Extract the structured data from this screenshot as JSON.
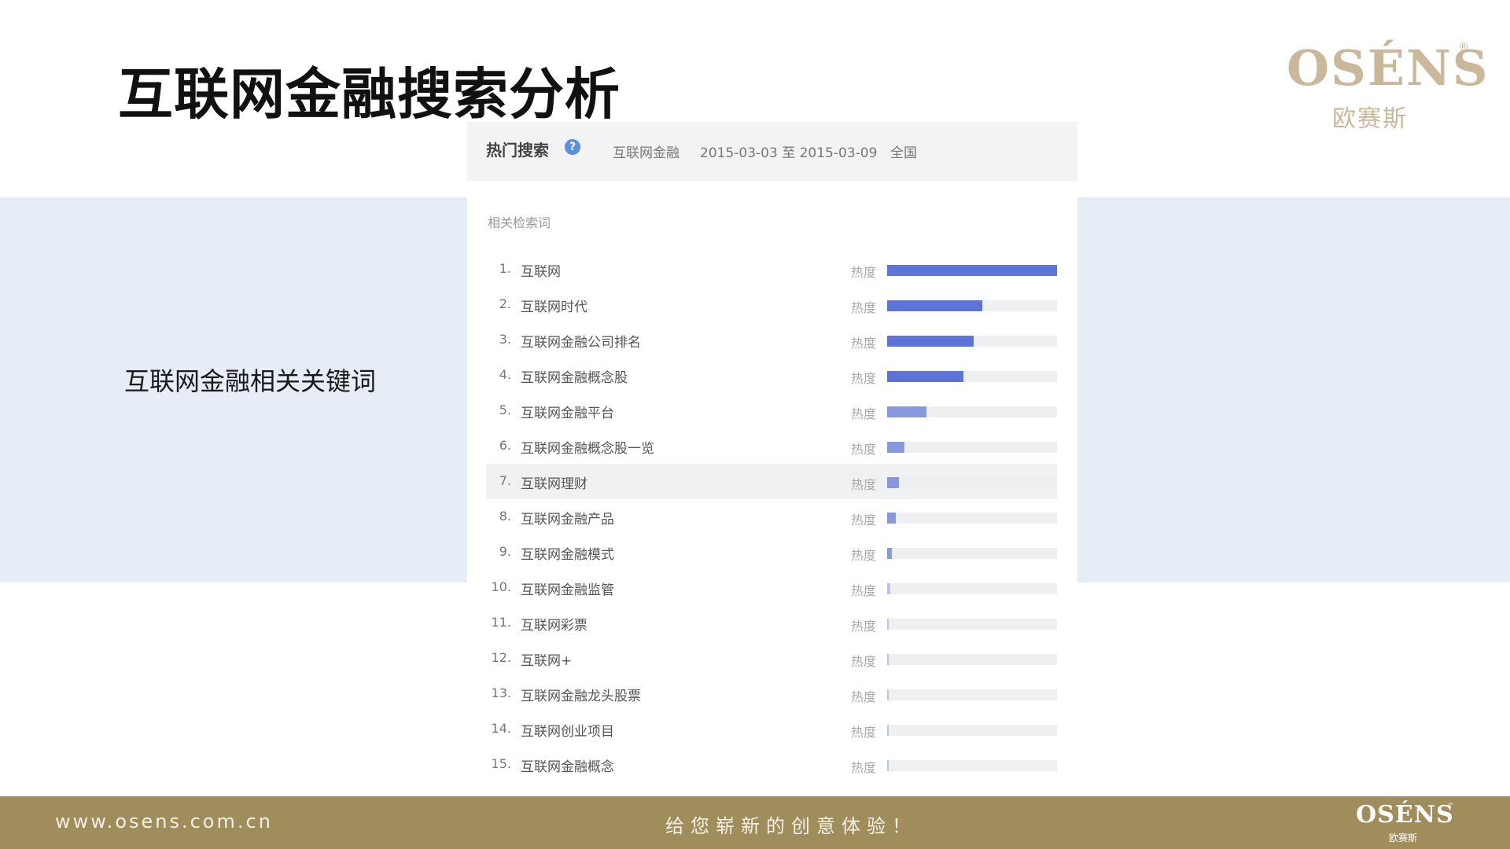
{
  "slide": {
    "title": "互联网金融搜索分析",
    "side_label": "互联网金融相关关键词"
  },
  "logo": {
    "brand": "OSÉNS",
    "reg_mark": "®",
    "subtitle": "欧赛斯",
    "color": "#c9b89a"
  },
  "panel": {
    "title": "热门搜索",
    "help_icon": "question-circle-icon",
    "keyword": "互联网金融",
    "date_range": "2015-03-03 至 2015-03-09",
    "region": "全国",
    "section_label": "相关检索词",
    "heat_label": "热度",
    "bar_color": "#5b74d6",
    "highlight_row": 7,
    "rows": [
      {
        "rank": "1.",
        "keyword": "互联网",
        "heat": 1.0
      },
      {
        "rank": "2.",
        "keyword": "互联网时代",
        "heat": 0.56
      },
      {
        "rank": "3.",
        "keyword": "互联网金融公司排名",
        "heat": 0.51
      },
      {
        "rank": "4.",
        "keyword": "互联网金融概念股",
        "heat": 0.45
      },
      {
        "rank": "5.",
        "keyword": "互联网金融平台",
        "heat": 0.23
      },
      {
        "rank": "6.",
        "keyword": "互联网金融概念股一览",
        "heat": 0.1
      },
      {
        "rank": "7.",
        "keyword": "互联网理财",
        "heat": 0.07
      },
      {
        "rank": "8.",
        "keyword": "互联网金融产品",
        "heat": 0.05
      },
      {
        "rank": "9.",
        "keyword": "互联网金融模式",
        "heat": 0.03
      },
      {
        "rank": "10.",
        "keyword": "互联网金融监管",
        "heat": 0.018
      },
      {
        "rank": "11.",
        "keyword": "互联网彩票",
        "heat": 0.01
      },
      {
        "rank": "12.",
        "keyword": "互联网+",
        "heat": 0.009
      },
      {
        "rank": "13.",
        "keyword": "互联网金融龙头股票",
        "heat": 0.008
      },
      {
        "rank": "14.",
        "keyword": "互联网创业项目",
        "heat": 0.007
      },
      {
        "rank": "15.",
        "keyword": "互联网金融概念",
        "heat": 0.006
      }
    ]
  },
  "footer": {
    "url": "www.osens.com.cn",
    "slogan": "给您崭新的创意体验！",
    "logo_brand": "OSÉNS",
    "logo_tm": "™",
    "logo_subtitle": "欧赛斯",
    "color": "#a08d5c"
  }
}
